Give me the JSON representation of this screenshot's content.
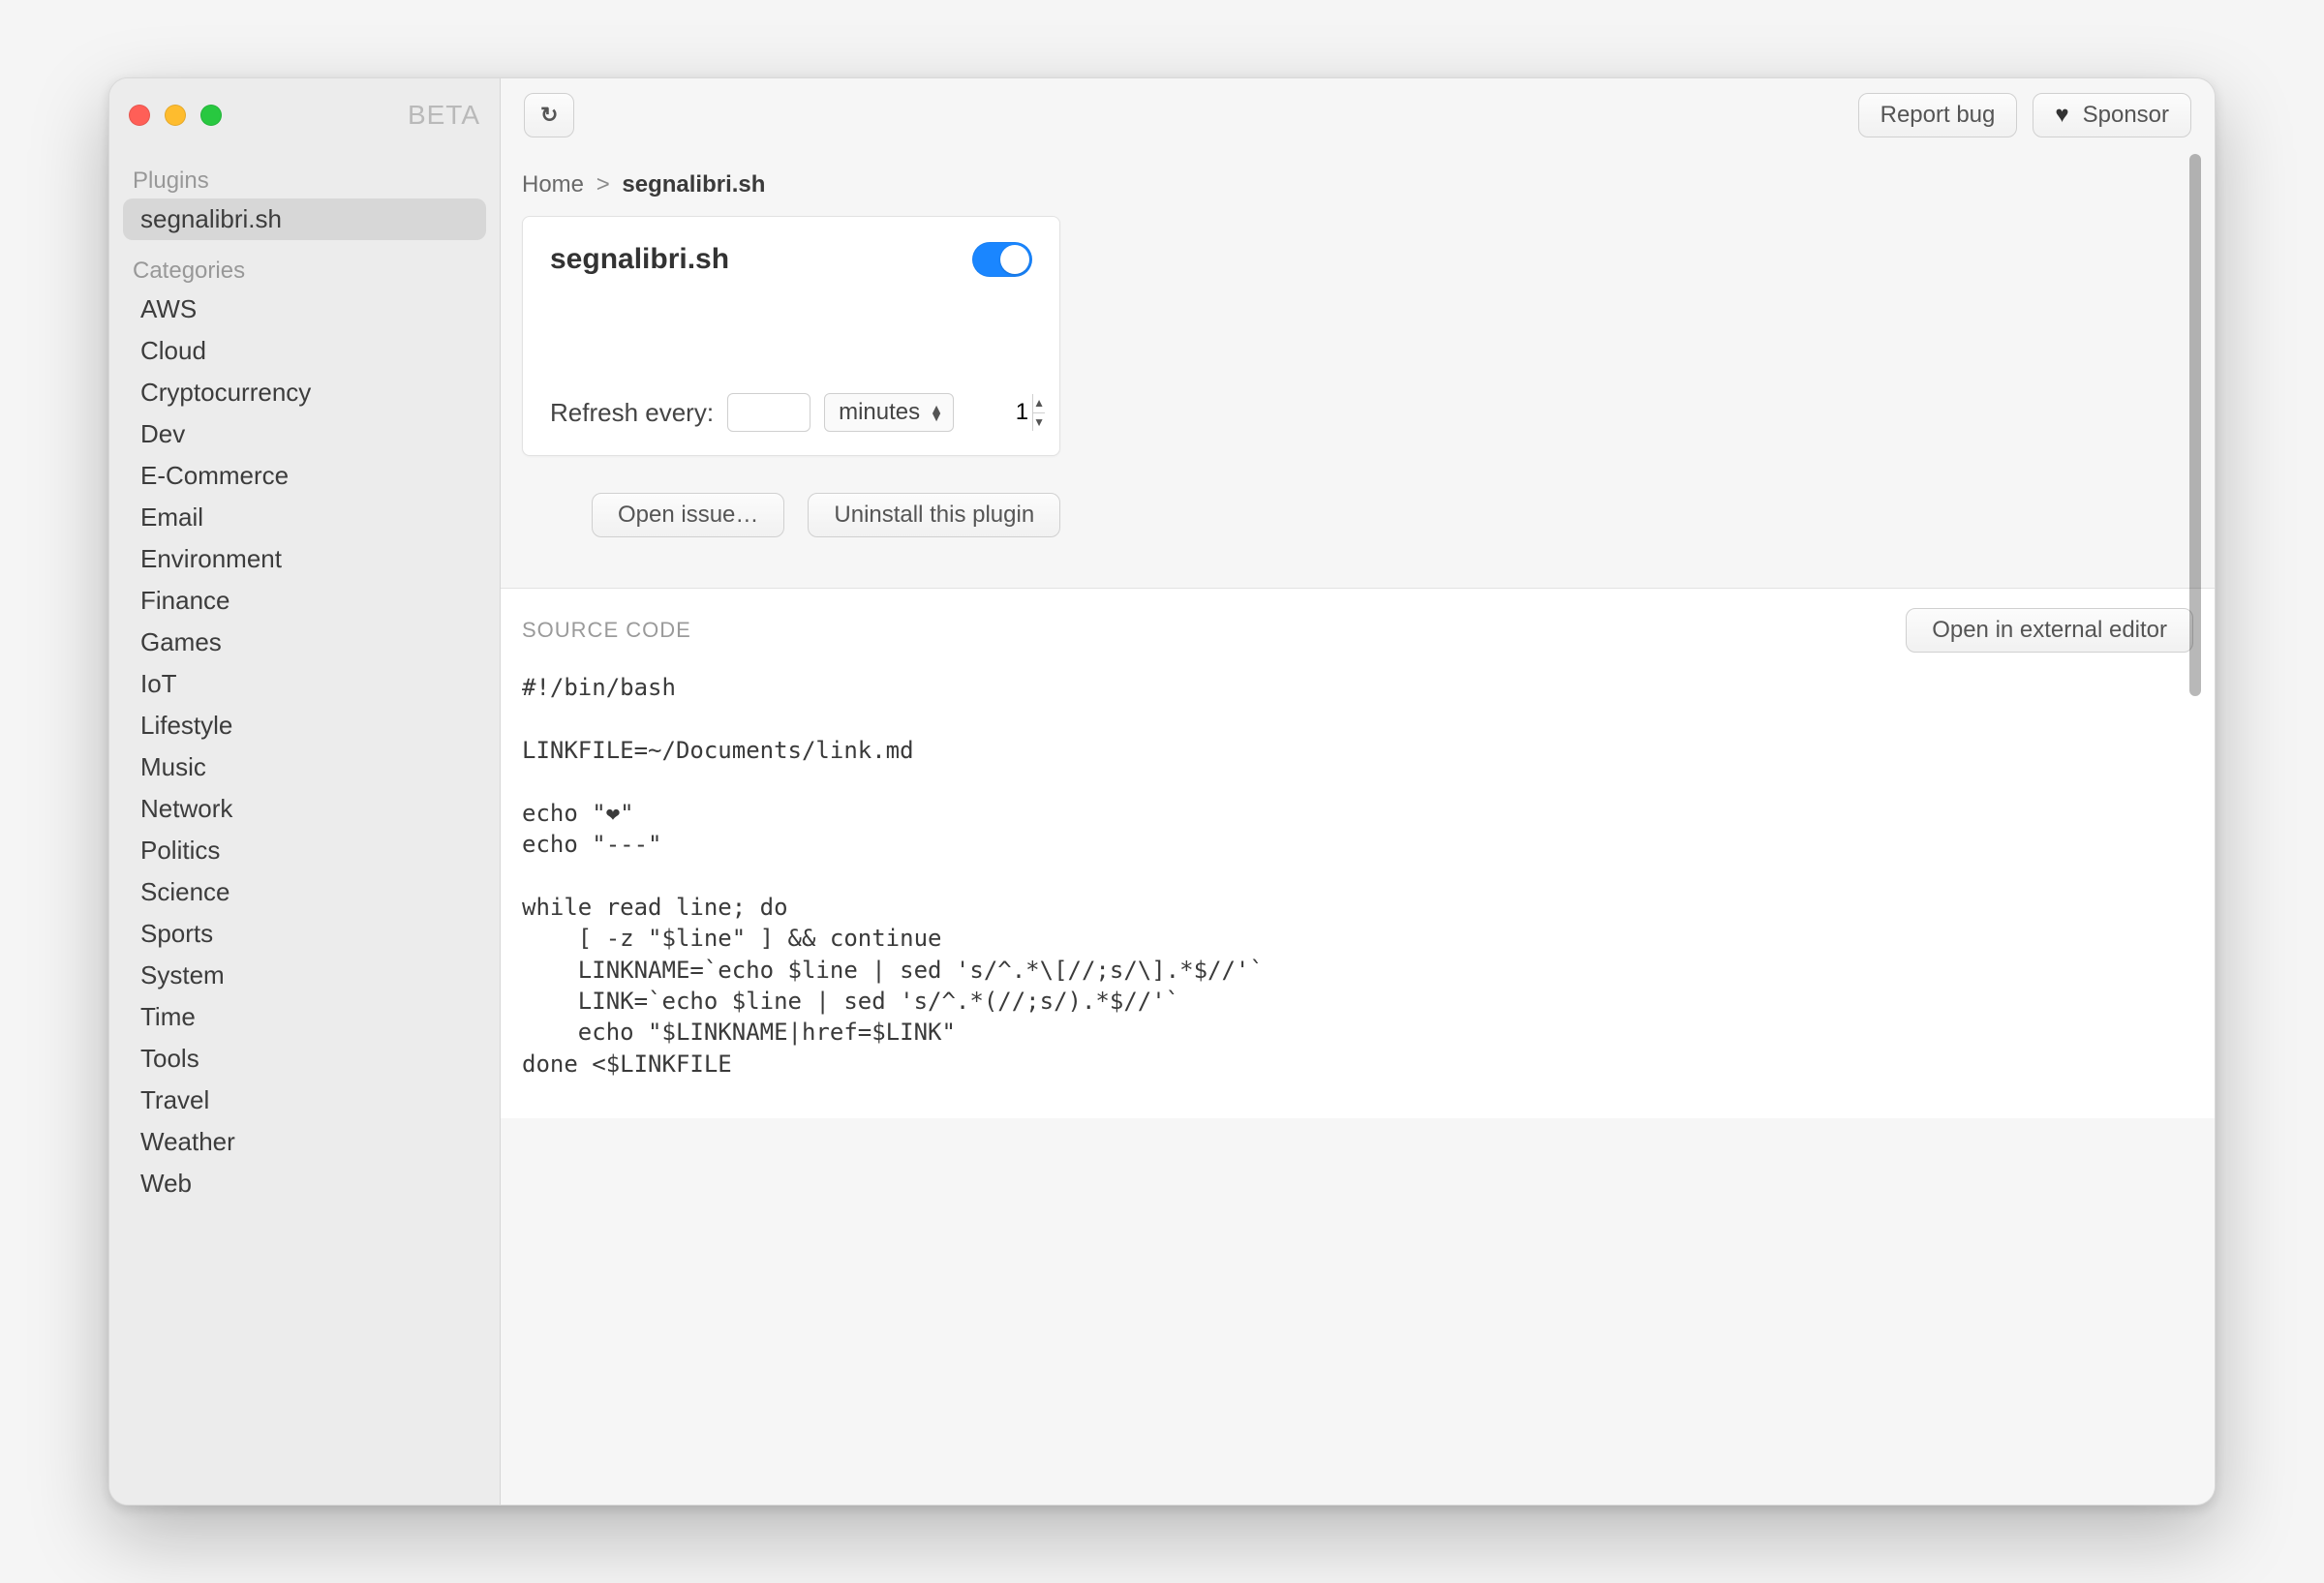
{
  "titlebar": {
    "beta": "BETA"
  },
  "toolbar": {
    "refresh_glyph": "↻",
    "report_bug": "Report bug",
    "sponsor_heart": "♥",
    "sponsor": "Sponsor"
  },
  "sidebar": {
    "plugins_label": "Plugins",
    "categories_label": "Categories",
    "plugins": [
      {
        "label": "segnalibri.sh",
        "selected": true
      }
    ],
    "categories": [
      "AWS",
      "Cloud",
      "Cryptocurrency",
      "Dev",
      "E-Commerce",
      "Email",
      "Environment",
      "Finance",
      "Games",
      "IoT",
      "Lifestyle",
      "Music",
      "Network",
      "Politics",
      "Science",
      "Sports",
      "System",
      "Time",
      "Tools",
      "Travel",
      "Weather",
      "Web"
    ]
  },
  "breadcrumb": {
    "home": "Home",
    "sep": ">",
    "current": "segnalibri.sh"
  },
  "card": {
    "title": "segnalibri.sh",
    "enabled": true,
    "refresh_label": "Refresh every:",
    "refresh_value": "1",
    "refresh_unit": "minutes"
  },
  "actions": {
    "open_issue": "Open issue…",
    "uninstall": "Uninstall this plugin"
  },
  "source": {
    "label": "SOURCE CODE",
    "open_external": "Open in external editor",
    "code": "#!/bin/bash\n\nLINKFILE=~/Documents/link.md\n\necho \"❤\"\necho \"---\"\n\nwhile read line; do\n    [ -z \"$line\" ] && continue\n    LINKNAME=`echo $line | sed 's/^.*\\[//;s/\\].*$//'`\n    LINK=`echo $line | sed 's/^.*(//;s/).*$//'`\n    echo \"$LINKNAME|href=$LINK\"\ndone <$LINKFILE"
  }
}
